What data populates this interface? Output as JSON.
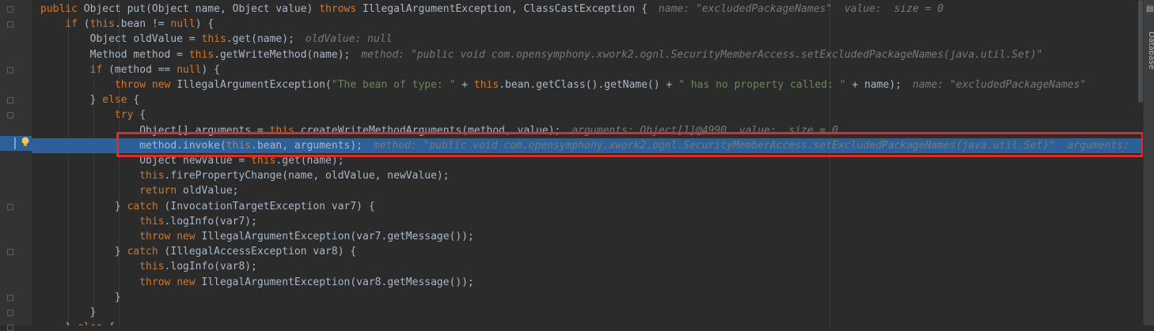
{
  "code_lines": [
    [
      {
        "t": "public ",
        "c": "kw"
      },
      {
        "t": "Object put(Object name, Object value) "
      },
      {
        "t": "throws ",
        "c": "kw"
      },
      {
        "t": "IllegalArgumentException, ClassCastException {"
      },
      {
        "t": "name: \"excludedPackageNames\"  value:  size = 0",
        "c": "hint"
      }
    ],
    [
      {
        "t": "    "
      },
      {
        "t": "if ",
        "c": "kw"
      },
      {
        "t": "("
      },
      {
        "t": "this",
        "c": "kw"
      },
      {
        "t": ".bean != "
      },
      {
        "t": "null",
        "c": "kw"
      },
      {
        "t": ") {"
      }
    ],
    [
      {
        "t": "        Object oldValue = "
      },
      {
        "t": "this",
        "c": "kw"
      },
      {
        "t": ".get(name);"
      },
      {
        "t": "oldValue: null",
        "c": "hint"
      }
    ],
    [
      {
        "t": "        Method method = "
      },
      {
        "t": "this",
        "c": "kw"
      },
      {
        "t": ".getWriteMethod(name);"
      },
      {
        "t": "method: \"public void com.opensymphony.xwork2.ognl.SecurityMemberAccess.setExcludedPackageNames(java.util.Set)\"",
        "c": "hint"
      }
    ],
    [
      {
        "t": "        "
      },
      {
        "t": "if ",
        "c": "kw"
      },
      {
        "t": "(method == "
      },
      {
        "t": "null",
        "c": "kw"
      },
      {
        "t": ") {"
      }
    ],
    [
      {
        "t": "            "
      },
      {
        "t": "throw new ",
        "c": "kw"
      },
      {
        "t": "IllegalArgumentException("
      },
      {
        "t": "\"The bean of type: \"",
        "c": "str"
      },
      {
        "t": " + "
      },
      {
        "t": "this",
        "c": "kw"
      },
      {
        "t": ".bean.getClass().getName() + "
      },
      {
        "t": "\" has no property called: \"",
        "c": "str"
      },
      {
        "t": " + name);"
      },
      {
        "t": "name: \"excludedPackageNames\"",
        "c": "hint"
      }
    ],
    [
      {
        "t": "        } "
      },
      {
        "t": "else ",
        "c": "kw"
      },
      {
        "t": "{"
      }
    ],
    [
      {
        "t": "            "
      },
      {
        "t": "try ",
        "c": "kw"
      },
      {
        "t": "{"
      }
    ],
    [
      {
        "t": "                Object[] arguments = "
      },
      {
        "t": "this",
        "c": "kw"
      },
      {
        "t": ".createWriteMethodArguments(method, value);"
      },
      {
        "t": "arguments: Object[1]@4990  value:  size = 0",
        "c": "hint"
      }
    ],
    [
      {
        "t": "                method.invoke("
      },
      {
        "t": "this",
        "c": "kw"
      },
      {
        "t": ".bean, arguments);"
      },
      {
        "t": "method: \"public void com.opensymphony.xwork2.ognl.SecurityMemberAccess.setExcludedPackageNames(java.util.Set)\"  arguments:",
        "c": "hint"
      }
    ],
    [
      {
        "t": "                Object newValue = "
      },
      {
        "t": "this",
        "c": "kw"
      },
      {
        "t": ".get(name);"
      }
    ],
    [
      {
        "t": "                "
      },
      {
        "t": "this",
        "c": "kw"
      },
      {
        "t": ".firePropertyChange(name, oldValue, newValue);"
      }
    ],
    [
      {
        "t": "                "
      },
      {
        "t": "return ",
        "c": "kw"
      },
      {
        "t": "oldValue;"
      }
    ],
    [
      {
        "t": "            } "
      },
      {
        "t": "catch ",
        "c": "kw"
      },
      {
        "t": "(InvocationTargetException var7) {"
      }
    ],
    [
      {
        "t": "                "
      },
      {
        "t": "this",
        "c": "kw"
      },
      {
        "t": ".logInfo(var7);"
      }
    ],
    [
      {
        "t": "                "
      },
      {
        "t": "throw new ",
        "c": "kw"
      },
      {
        "t": "IllegalArgumentException(var7.getMessage());"
      }
    ],
    [
      {
        "t": "            } "
      },
      {
        "t": "catch ",
        "c": "kw"
      },
      {
        "t": "(IllegalAccessException var8) {"
      }
    ],
    [
      {
        "t": "                "
      },
      {
        "t": "this",
        "c": "kw"
      },
      {
        "t": ".logInfo(var8);"
      }
    ],
    [
      {
        "t": "                "
      },
      {
        "t": "throw new ",
        "c": "kw"
      },
      {
        "t": "IllegalArgumentException(var8.getMessage());"
      }
    ],
    [
      {
        "t": "            }"
      }
    ],
    [
      {
        "t": "        }"
      }
    ],
    [
      {
        "t": "    } "
      },
      {
        "t": "else ",
        "c": "kw"
      },
      {
        "t": "{"
      }
    ]
  ],
  "exec_line_index": 9,
  "right_panel_label": "Database",
  "colors": {
    "background": "#2b2b2b",
    "keyword": "#cc7832",
    "string": "#6a8759",
    "text": "#a9b7c6",
    "hint": "#787878",
    "execution_line": "#2d6099",
    "highlight_box": "#e02b2b"
  },
  "icons": [
    "fold-marker-icon",
    "intention-bulb-icon",
    "database-tool-icon"
  ]
}
